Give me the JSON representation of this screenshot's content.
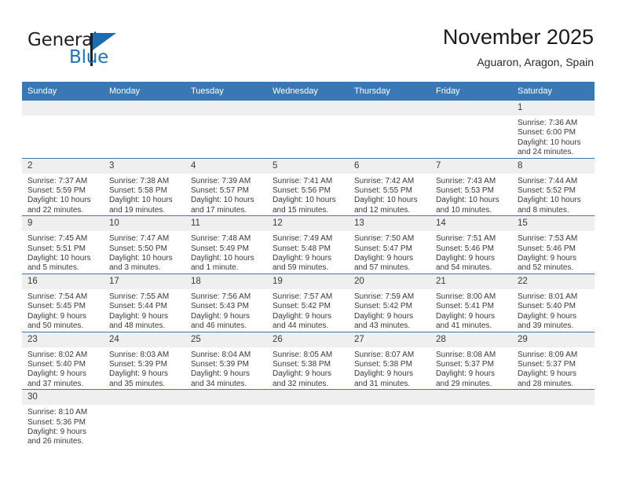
{
  "brand": {
    "name_part1": "General",
    "name_part2": "Blue",
    "accent_color": "#1b6cb0"
  },
  "header": {
    "title": "November 2025",
    "subtitle": "Aguaron, Aragon, Spain"
  },
  "theme": {
    "header_bg": "#3a78b5",
    "daynum_bg": "#efefef",
    "text": "#3a3a3a"
  },
  "weekday_headers": [
    "Sunday",
    "Monday",
    "Tuesday",
    "Wednesday",
    "Thursday",
    "Friday",
    "Saturday"
  ],
  "labels": {
    "sunrise": "Sunrise:",
    "sunset": "Sunset:",
    "daylight": "Daylight:"
  },
  "weeks": [
    [
      {
        "empty": true
      },
      {
        "empty": true
      },
      {
        "empty": true
      },
      {
        "empty": true
      },
      {
        "empty": true
      },
      {
        "empty": true
      },
      {
        "day": "1",
        "sunrise": "Sunrise: 7:36 AM",
        "sunset": "Sunset: 6:00 PM",
        "daylight1": "Daylight: 10 hours",
        "daylight2": "and 24 minutes."
      }
    ],
    [
      {
        "day": "2",
        "sunrise": "Sunrise: 7:37 AM",
        "sunset": "Sunset: 5:59 PM",
        "daylight1": "Daylight: 10 hours",
        "daylight2": "and 22 minutes."
      },
      {
        "day": "3",
        "sunrise": "Sunrise: 7:38 AM",
        "sunset": "Sunset: 5:58 PM",
        "daylight1": "Daylight: 10 hours",
        "daylight2": "and 19 minutes."
      },
      {
        "day": "4",
        "sunrise": "Sunrise: 7:39 AM",
        "sunset": "Sunset: 5:57 PM",
        "daylight1": "Daylight: 10 hours",
        "daylight2": "and 17 minutes."
      },
      {
        "day": "5",
        "sunrise": "Sunrise: 7:41 AM",
        "sunset": "Sunset: 5:56 PM",
        "daylight1": "Daylight: 10 hours",
        "daylight2": "and 15 minutes."
      },
      {
        "day": "6",
        "sunrise": "Sunrise: 7:42 AM",
        "sunset": "Sunset: 5:55 PM",
        "daylight1": "Daylight: 10 hours",
        "daylight2": "and 12 minutes."
      },
      {
        "day": "7",
        "sunrise": "Sunrise: 7:43 AM",
        "sunset": "Sunset: 5:53 PM",
        "daylight1": "Daylight: 10 hours",
        "daylight2": "and 10 minutes."
      },
      {
        "day": "8",
        "sunrise": "Sunrise: 7:44 AM",
        "sunset": "Sunset: 5:52 PM",
        "daylight1": "Daylight: 10 hours",
        "daylight2": "and 8 minutes."
      }
    ],
    [
      {
        "day": "9",
        "sunrise": "Sunrise: 7:45 AM",
        "sunset": "Sunset: 5:51 PM",
        "daylight1": "Daylight: 10 hours",
        "daylight2": "and 5 minutes."
      },
      {
        "day": "10",
        "sunrise": "Sunrise: 7:47 AM",
        "sunset": "Sunset: 5:50 PM",
        "daylight1": "Daylight: 10 hours",
        "daylight2": "and 3 minutes."
      },
      {
        "day": "11",
        "sunrise": "Sunrise: 7:48 AM",
        "sunset": "Sunset: 5:49 PM",
        "daylight1": "Daylight: 10 hours",
        "daylight2": "and 1 minute."
      },
      {
        "day": "12",
        "sunrise": "Sunrise: 7:49 AM",
        "sunset": "Sunset: 5:48 PM",
        "daylight1": "Daylight: 9 hours",
        "daylight2": "and 59 minutes."
      },
      {
        "day": "13",
        "sunrise": "Sunrise: 7:50 AM",
        "sunset": "Sunset: 5:47 PM",
        "daylight1": "Daylight: 9 hours",
        "daylight2": "and 57 minutes."
      },
      {
        "day": "14",
        "sunrise": "Sunrise: 7:51 AM",
        "sunset": "Sunset: 5:46 PM",
        "daylight1": "Daylight: 9 hours",
        "daylight2": "and 54 minutes."
      },
      {
        "day": "15",
        "sunrise": "Sunrise: 7:53 AM",
        "sunset": "Sunset: 5:46 PM",
        "daylight1": "Daylight: 9 hours",
        "daylight2": "and 52 minutes."
      }
    ],
    [
      {
        "day": "16",
        "sunrise": "Sunrise: 7:54 AM",
        "sunset": "Sunset: 5:45 PM",
        "daylight1": "Daylight: 9 hours",
        "daylight2": "and 50 minutes."
      },
      {
        "day": "17",
        "sunrise": "Sunrise: 7:55 AM",
        "sunset": "Sunset: 5:44 PM",
        "daylight1": "Daylight: 9 hours",
        "daylight2": "and 48 minutes."
      },
      {
        "day": "18",
        "sunrise": "Sunrise: 7:56 AM",
        "sunset": "Sunset: 5:43 PM",
        "daylight1": "Daylight: 9 hours",
        "daylight2": "and 46 minutes."
      },
      {
        "day": "19",
        "sunrise": "Sunrise: 7:57 AM",
        "sunset": "Sunset: 5:42 PM",
        "daylight1": "Daylight: 9 hours",
        "daylight2": "and 44 minutes."
      },
      {
        "day": "20",
        "sunrise": "Sunrise: 7:59 AM",
        "sunset": "Sunset: 5:42 PM",
        "daylight1": "Daylight: 9 hours",
        "daylight2": "and 43 minutes."
      },
      {
        "day": "21",
        "sunrise": "Sunrise: 8:00 AM",
        "sunset": "Sunset: 5:41 PM",
        "daylight1": "Daylight: 9 hours",
        "daylight2": "and 41 minutes."
      },
      {
        "day": "22",
        "sunrise": "Sunrise: 8:01 AM",
        "sunset": "Sunset: 5:40 PM",
        "daylight1": "Daylight: 9 hours",
        "daylight2": "and 39 minutes."
      }
    ],
    [
      {
        "day": "23",
        "sunrise": "Sunrise: 8:02 AM",
        "sunset": "Sunset: 5:40 PM",
        "daylight1": "Daylight: 9 hours",
        "daylight2": "and 37 minutes."
      },
      {
        "day": "24",
        "sunrise": "Sunrise: 8:03 AM",
        "sunset": "Sunset: 5:39 PM",
        "daylight1": "Daylight: 9 hours",
        "daylight2": "and 35 minutes."
      },
      {
        "day": "25",
        "sunrise": "Sunrise: 8:04 AM",
        "sunset": "Sunset: 5:39 PM",
        "daylight1": "Daylight: 9 hours",
        "daylight2": "and 34 minutes."
      },
      {
        "day": "26",
        "sunrise": "Sunrise: 8:05 AM",
        "sunset": "Sunset: 5:38 PM",
        "daylight1": "Daylight: 9 hours",
        "daylight2": "and 32 minutes."
      },
      {
        "day": "27",
        "sunrise": "Sunrise: 8:07 AM",
        "sunset": "Sunset: 5:38 PM",
        "daylight1": "Daylight: 9 hours",
        "daylight2": "and 31 minutes."
      },
      {
        "day": "28",
        "sunrise": "Sunrise: 8:08 AM",
        "sunset": "Sunset: 5:37 PM",
        "daylight1": "Daylight: 9 hours",
        "daylight2": "and 29 minutes."
      },
      {
        "day": "29",
        "sunrise": "Sunrise: 8:09 AM",
        "sunset": "Sunset: 5:37 PM",
        "daylight1": "Daylight: 9 hours",
        "daylight2": "and 28 minutes."
      }
    ],
    [
      {
        "day": "30",
        "sunrise": "Sunrise: 8:10 AM",
        "sunset": "Sunset: 5:36 PM",
        "daylight1": "Daylight: 9 hours",
        "daylight2": "and 26 minutes."
      },
      {
        "empty": true
      },
      {
        "empty": true
      },
      {
        "empty": true
      },
      {
        "empty": true
      },
      {
        "empty": true
      },
      {
        "empty": true
      }
    ]
  ]
}
